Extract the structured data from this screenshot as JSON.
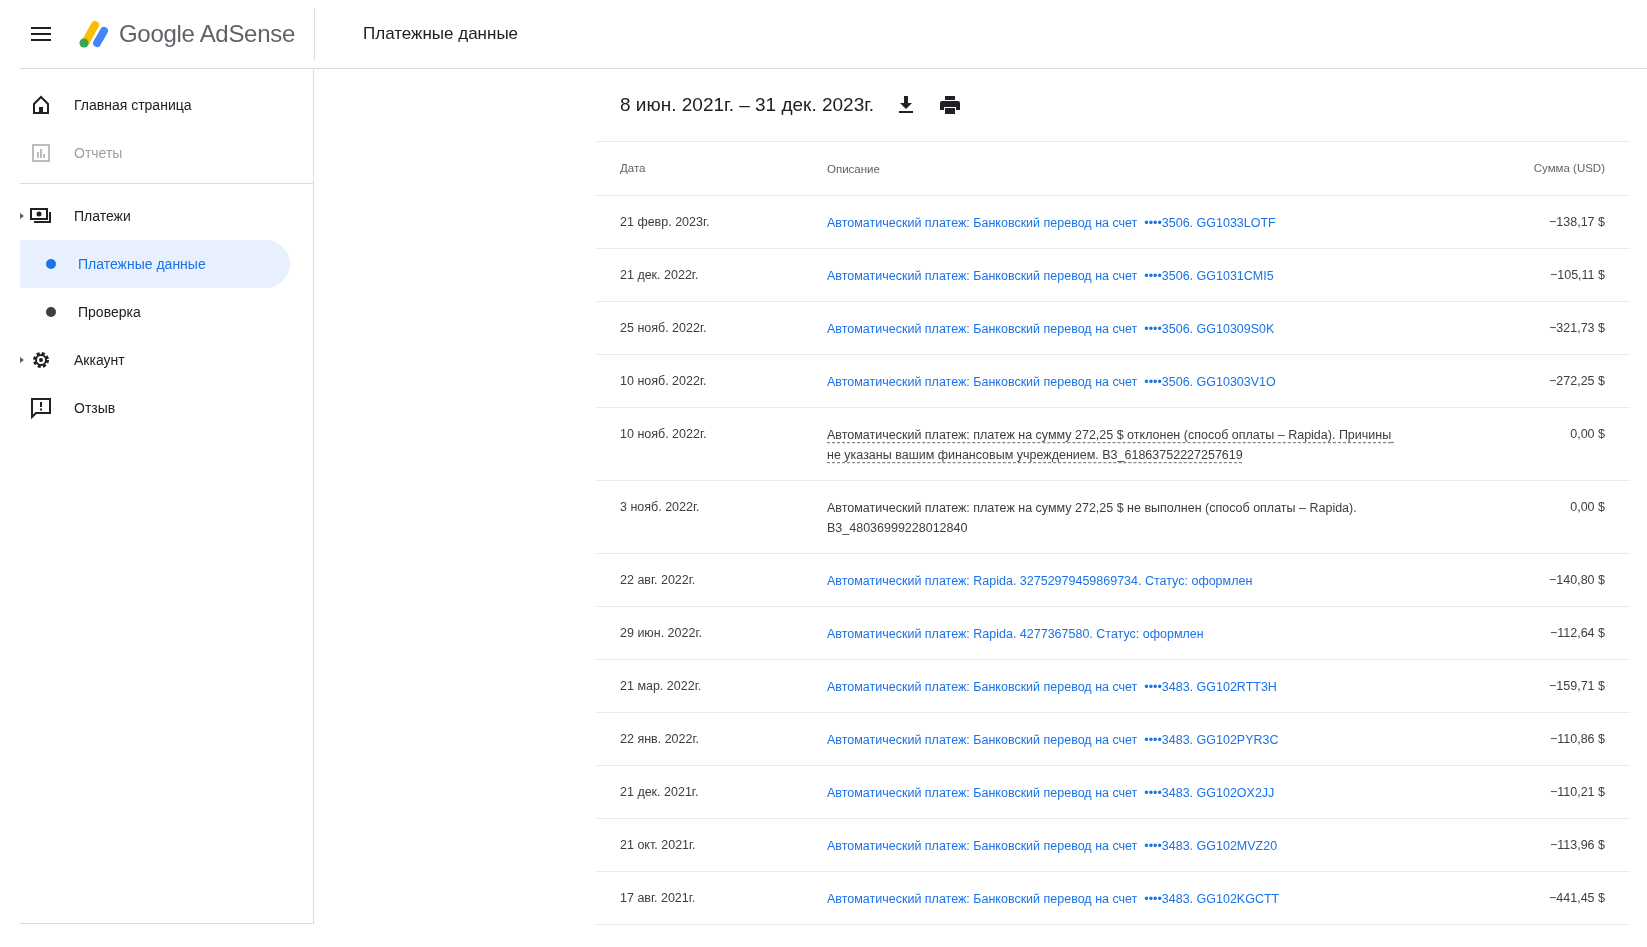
{
  "header": {
    "brand": "Google AdSense",
    "page_title": "Платежные данные"
  },
  "sidebar": {
    "groups": [
      {
        "items": [
          {
            "kind": "home",
            "label": "Главная страница",
            "disabled": false,
            "expandable": false
          },
          {
            "kind": "reports",
            "label": "Отчеты",
            "disabled": true,
            "expandable": false
          }
        ]
      },
      {
        "items": [
          {
            "kind": "payments",
            "label": "Платежи",
            "disabled": false,
            "expandable": true,
            "children": [
              {
                "label": "Платежные данные",
                "selected": true
              },
              {
                "label": "Проверка",
                "selected": false
              }
            ]
          },
          {
            "kind": "settings",
            "label": "Аккаунт",
            "disabled": false,
            "expandable": true
          },
          {
            "kind": "feedback",
            "label": "Отзыв",
            "disabled": false,
            "expandable": false
          }
        ]
      }
    ]
  },
  "date_range": "8 июн. 2021г. – 31 дек. 2023г.",
  "table": {
    "columns": [
      "Дата",
      "Описание",
      "Сумма (USD)"
    ],
    "rows": [
      {
        "date": "21 февр. 2023г.",
        "kind": "link",
        "description": "Автоматический платеж: Банковский перевод на счет  ••••3506. GG1033LOTF",
        "amount": "−138,17 $"
      },
      {
        "date": "21 дек. 2022г.",
        "kind": "link",
        "description": "Автоматический платеж: Банковский перевод на счет  ••••3506. GG1031CMI5",
        "amount": "−105,11 $"
      },
      {
        "date": "25 нояб. 2022г.",
        "kind": "link",
        "description": "Автоматический платеж: Банковский перевод на счет  ••••3506. GG10309S0K",
        "amount": "−321,73 $"
      },
      {
        "date": "10 нояб. 2022г.",
        "kind": "link",
        "description": "Автоматический платеж: Банковский перевод на счет  ••••3506. GG10303V1O",
        "amount": "−272,25 $"
      },
      {
        "date": "10 нояб. 2022г.",
        "kind": "tooltip",
        "description": "Автоматический платеж: платеж на сумму 272,25 $ отклонен (способ оплаты – Rapida). Причины не указаны вашим финансовым учреждением. B3_61863752227257619",
        "amount": "0,00 $"
      },
      {
        "date": "3 нояб. 2022г.",
        "kind": "plain",
        "description": "Автоматический платеж: платеж на сумму 272,25 $ не выполнен (способ оплаты – Rapida). B3_48036999228012840",
        "amount": "0,00 $"
      },
      {
        "date": "22 авг. 2022г.",
        "kind": "link",
        "description": "Автоматический платеж: Rapida. 32752979459869734. Статус: оформлен",
        "amount": "−140,80 $"
      },
      {
        "date": "29 июн. 2022г.",
        "kind": "link",
        "description": "Автоматический платеж: Rapida. 4277367580. Статус: оформлен",
        "amount": "−112,64 $"
      },
      {
        "date": "21 мар. 2022г.",
        "kind": "link",
        "description": "Автоматический платеж: Банковский перевод на счет  ••••3483. GG102RTT3H",
        "amount": "−159,71 $"
      },
      {
        "date": "22 янв. 2022г.",
        "kind": "link",
        "description": "Автоматический платеж: Банковский перевод на счет  ••••3483. GG102PYR3C",
        "amount": "−110,86 $"
      },
      {
        "date": "21 дек. 2021г.",
        "kind": "link",
        "description": "Автоматический платеж: Банковский перевод на счет  ••••3483. GG102OX2JJ",
        "amount": "−110,21 $"
      },
      {
        "date": "21 окт. 2021г.",
        "kind": "link",
        "description": "Автоматический платеж: Банковский перевод на счет  ••••3483. GG102MVZ20",
        "amount": "−113,96 $"
      },
      {
        "date": "17 авг. 2021г.",
        "kind": "link",
        "description": "Автоматический платеж: Банковский перевод на счет  ••••3483. GG102KGCTT",
        "amount": "−441,45 $"
      }
    ]
  }
}
